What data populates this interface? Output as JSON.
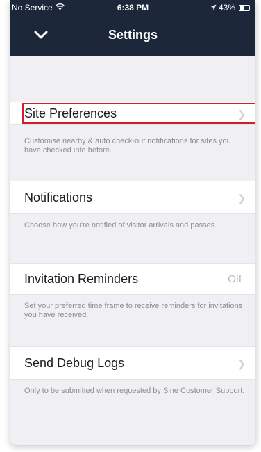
{
  "status_bar": {
    "carrier": "No Service",
    "time": "6:38 PM",
    "battery": "43%",
    "wifi_icon": "wifi-icon",
    "location_icon": "location-arrow-icon"
  },
  "nav": {
    "title": "Settings",
    "back_icon": "chevron-down-icon"
  },
  "settings": [
    {
      "label": "Site Preferences",
      "description": "Customise nearby & auto check-out notifications for sites you have checked into before.",
      "accessory": "chevron-right-icon",
      "highlighted": true
    },
    {
      "label": "Notifications",
      "description": "Choose how you're notified of visitor arrivals and passes.",
      "accessory": "chevron-right-icon"
    },
    {
      "label": "Invitation Reminders",
      "value": "Off",
      "description": "Set your preferred time frame to receive reminders for invitations you have received."
    },
    {
      "label": "Send Debug Logs",
      "description": "Only to be submitted when requested by Sine Customer Support.",
      "accessory": "chevron-right-icon"
    }
  ],
  "colors": {
    "nav_background": "#1c2739",
    "background": "#efeff4",
    "highlight": "#d0202a"
  }
}
